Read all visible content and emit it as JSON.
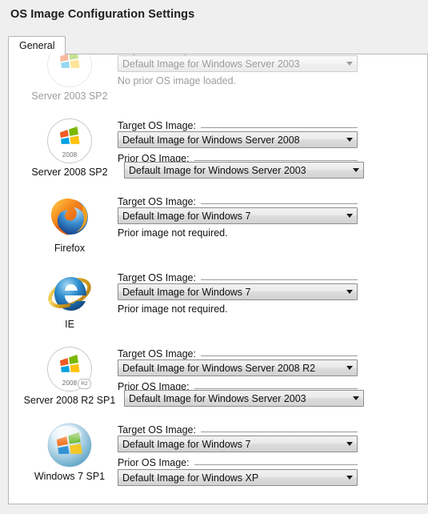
{
  "window": {
    "title": "OS Image Configuration Settings"
  },
  "tabs": [
    {
      "label": "General",
      "selected": true
    }
  ],
  "labels": {
    "target": "Target OS Image:",
    "prior": "Prior OS Image:",
    "no_prior_required": "Prior image not required.",
    "no_prior_loaded": "No prior OS image loaded."
  },
  "colors": {
    "page_bg": "#efefef",
    "panel_bg": "#ffffff",
    "panel_border": "#b6b6b6",
    "text": "#111111",
    "faded_text": "#b3b3b3",
    "combo_border": "#8d8d8d"
  },
  "rows": [
    {
      "id": "server-2003-sp2",
      "caption": "Server 2003 SP2",
      "icon": "windows-server-2003-icon",
      "icon_year": "",
      "faded": true,
      "clipped_top": true,
      "target_label": "Target OS Image:",
      "target_value": "Default Image for Windows Server 2003",
      "prior_mode": "note",
      "prior_note": "No prior OS image loaded.",
      "prior_label": "",
      "prior_value": ""
    },
    {
      "id": "server-2008-sp2",
      "caption": "Server 2008 SP2",
      "icon": "windows-server-2008-icon",
      "icon_year": "2008",
      "faded": false,
      "clipped_top": false,
      "target_label": "Target OS Image:",
      "target_value": "Default Image for Windows Server 2008",
      "prior_mode": "combo",
      "prior_note": "",
      "prior_label": "Prior OS Image:",
      "prior_value": "Default Image for Windows Server 2003",
      "caption_overlaps_prior": true
    },
    {
      "id": "firefox",
      "caption": "Firefox",
      "icon": "firefox-icon",
      "icon_year": "",
      "faded": false,
      "clipped_top": false,
      "target_label": "Target OS Image:",
      "target_value": "Default Image for Windows 7",
      "prior_mode": "note",
      "prior_note": "Prior image not required.",
      "prior_label": "",
      "prior_value": ""
    },
    {
      "id": "ie",
      "caption": "IE",
      "icon": "internet-explorer-icon",
      "icon_year": "",
      "faded": false,
      "clipped_top": false,
      "target_label": "Target OS Image:",
      "target_value": "Default Image for Windows 7",
      "prior_mode": "note",
      "prior_note": "Prior image not required.",
      "prior_label": "",
      "prior_value": ""
    },
    {
      "id": "server-2008-r2-sp1",
      "caption": "Server 2008 R2 SP1",
      "icon": "windows-server-2008-r2-icon",
      "icon_year": "2008",
      "icon_badge": "R2",
      "faded": false,
      "clipped_top": false,
      "target_label": "Target OS Image:",
      "target_value": "Default Image for Windows Server 2008 R2",
      "prior_mode": "combo",
      "prior_note": "",
      "prior_label": "Prior OS Image:",
      "prior_value": "Default Image for Windows Server 2003",
      "caption_overlaps_prior": true
    },
    {
      "id": "windows-7-sp1",
      "caption": "Windows 7 SP1",
      "icon": "windows-7-icon",
      "icon_year": "",
      "faded": false,
      "clipped_top": false,
      "target_label": "Target OS Image:",
      "target_value": "Default Image for Windows 7",
      "prior_mode": "combo",
      "prior_note": "",
      "prior_label": "Prior OS Image:",
      "prior_value": "Default Image for Windows XP",
      "caption_overlaps_prior": false
    }
  ]
}
